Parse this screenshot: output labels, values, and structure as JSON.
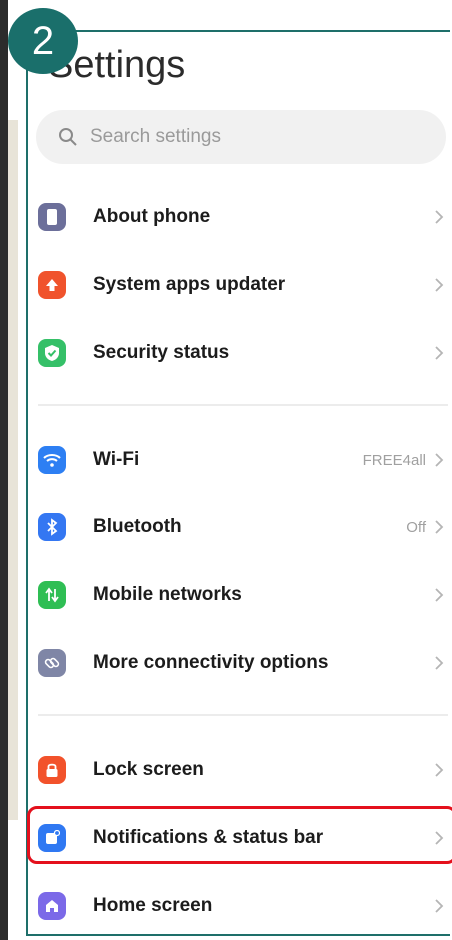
{
  "step_number": "2",
  "page_title": "Settings",
  "search": {
    "placeholder": "Search settings"
  },
  "items": [
    {
      "label": "About phone",
      "value": "",
      "icon": "phone-icon",
      "color": "#6c6f9a"
    },
    {
      "label": "System apps updater",
      "value": "",
      "icon": "arrow-up-icon",
      "color": "#f0532c"
    },
    {
      "label": "Security status",
      "value": "",
      "icon": "shield-icon",
      "color": "#35c068"
    },
    {
      "label": "Wi-Fi",
      "value": "FREE4all",
      "icon": "wifi-icon",
      "color": "#2d7ff3"
    },
    {
      "label": "Bluetooth",
      "value": "Off",
      "icon": "bluetooth-icon",
      "color": "#3477f2"
    },
    {
      "label": "Mobile networks",
      "value": "",
      "icon": "mobile-data-icon",
      "color": "#2fbe54"
    },
    {
      "label": "More connectivity options",
      "value": "",
      "icon": "link-icon",
      "color": "#7f86a6"
    },
    {
      "label": "Lock screen",
      "value": "",
      "icon": "lock-icon",
      "color": "#f2522b"
    },
    {
      "label": "Notifications & status bar",
      "value": "",
      "icon": "notification-icon",
      "color": "#2f78f2"
    },
    {
      "label": "Home screen",
      "value": "",
      "icon": "home-icon",
      "color": "#7b69e8"
    }
  ],
  "highlighted_item": "Notifications & status bar",
  "highlight_color": "#e4101c",
  "badge_color": "#1a6f6b"
}
